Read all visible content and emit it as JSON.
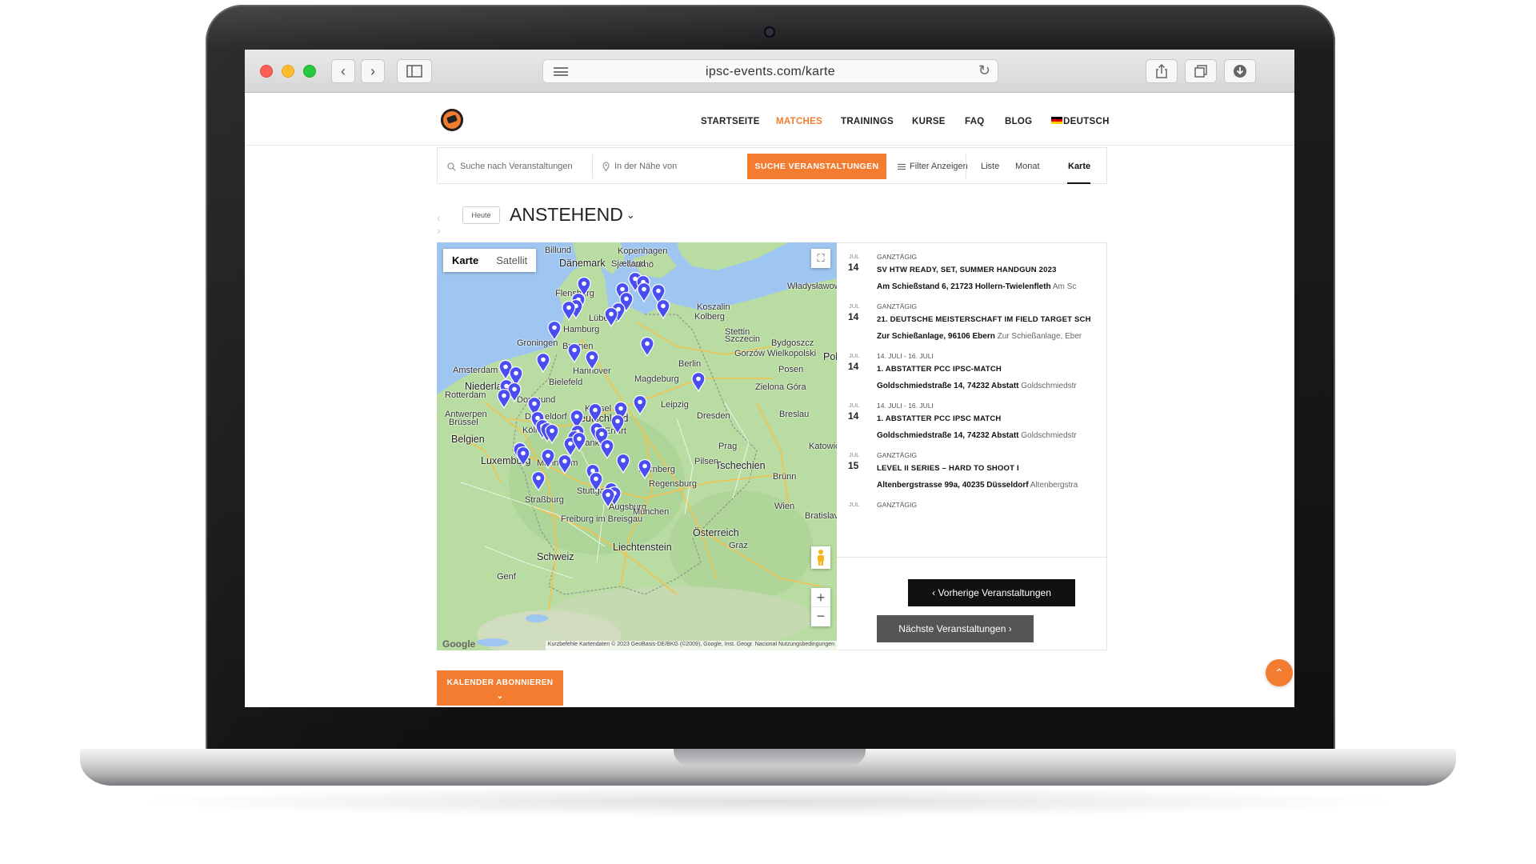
{
  "browser": {
    "url": "ipsc-events.com/karte",
    "back_glyph": "‹",
    "forward_glyph": "›"
  },
  "nav": {
    "items": [
      "STARTSEITE",
      "MATCHES",
      "TRAININGS",
      "KURSE",
      "FAQ",
      "BLOG"
    ],
    "active": "MATCHES",
    "language": "DEUTSCH"
  },
  "search": {
    "keyword_placeholder": "Suche nach Veranstaltungen",
    "location_placeholder": "In der Nähe von",
    "submit_label": "SUCHE VERANSTALTUNGEN",
    "filter_label": "Filter Anzeigen",
    "views": [
      "Liste",
      "Monat",
      "Karte"
    ],
    "active_view": "Karte"
  },
  "datenav": {
    "today_label": "Heute",
    "heading": "ANSTEHEND"
  },
  "map": {
    "type_buttons": [
      "Karte",
      "Satellit"
    ],
    "active_type": "Karte",
    "labels": [
      {
        "text": "Kopenhagen",
        "big": false
      },
      {
        "text": "Dänemark",
        "big": true
      },
      {
        "text": "Malmö",
        "big": false
      },
      {
        "text": "Billund",
        "big": false
      },
      {
        "text": "Sjælland",
        "big": false
      },
      {
        "text": "Władysławowo",
        "big": false
      },
      {
        "text": "Flensburg",
        "big": false
      },
      {
        "text": "Lübeck",
        "big": false
      },
      {
        "text": "Hamburg",
        "big": false
      },
      {
        "text": "Bremen",
        "big": false
      },
      {
        "text": "Groningen",
        "big": false
      },
      {
        "text": "Szczecin",
        "big": false
      },
      {
        "text": "Stettin",
        "big": false
      },
      {
        "text": "Koszalin",
        "big": false
      },
      {
        "text": "Kolberg",
        "big": false
      },
      {
        "text": "Bydgoszcz",
        "big": false
      },
      {
        "text": "Pol",
        "big": true
      },
      {
        "text": "Amsterdam",
        "big": false
      },
      {
        "text": "Niederlande",
        "big": true
      },
      {
        "text": "Rotterdam",
        "big": false
      },
      {
        "text": "Antwerpen",
        "big": false
      },
      {
        "text": "Brüssel",
        "big": false
      },
      {
        "text": "Belgien",
        "big": true
      },
      {
        "text": "Luxemburg",
        "big": true
      },
      {
        "text": "Dortmund",
        "big": false
      },
      {
        "text": "Düsseldorf",
        "big": false
      },
      {
        "text": "Köln",
        "big": false
      },
      {
        "text": "Bielefeld",
        "big": false
      },
      {
        "text": "Hannover",
        "big": false
      },
      {
        "text": "Magdeburg",
        "big": false
      },
      {
        "text": "Berlin",
        "big": false
      },
      {
        "text": "Gorzów Wielkopolski",
        "big": false
      },
      {
        "text": "Posen",
        "big": false
      },
      {
        "text": "Zielona Góra",
        "big": false
      },
      {
        "text": "Kassel",
        "big": false
      },
      {
        "text": "Leipzig",
        "big": false
      },
      {
        "text": "Dresden",
        "big": false
      },
      {
        "text": "Breslau",
        "big": false
      },
      {
        "text": "Deutschland",
        "big": true
      },
      {
        "text": "Erfurt",
        "big": false
      },
      {
        "text": "Frankfurt",
        "big": false
      },
      {
        "text": "Prag",
        "big": false
      },
      {
        "text": "Tschechien",
        "big": true
      },
      {
        "text": "Katowice",
        "big": false
      },
      {
        "text": "Nürnberg",
        "big": false
      },
      {
        "text": "Pilsen",
        "big": false
      },
      {
        "text": "Mannheim",
        "big": false
      },
      {
        "text": "Stuttgart",
        "big": false
      },
      {
        "text": "Regensburg",
        "big": false
      },
      {
        "text": "Brünn",
        "big": false
      },
      {
        "text": "Straßburg",
        "big": false
      },
      {
        "text": "Augsburg",
        "big": false
      },
      {
        "text": "München",
        "big": false
      },
      {
        "text": "Wien",
        "big": false
      },
      {
        "text": "Bratislava",
        "big": false
      },
      {
        "text": "Freiburg im Breisgau",
        "big": false
      },
      {
        "text": "Österreich",
        "big": true
      },
      {
        "text": "Liechtenstein",
        "big": true
      },
      {
        "text": "Graz",
        "big": false
      },
      {
        "text": "Schweiz",
        "big": true
      },
      {
        "text": "Genf",
        "big": false
      }
    ],
    "google_logo": "Google",
    "attribution": "Kurzbefehle   Kartendaten © 2023 GeoBasis-DE/BKG (©2009), Google, Inst. Geogr. Nacional   Nutzungsbedingungen",
    "zoom_in": "+",
    "zoom_out": "−",
    "fullscreen_icon": "⛶",
    "pegman_icon": "person-icon",
    "marker_color": "#4a4ef0"
  },
  "events": [
    {
      "month": "JUL",
      "day": "14",
      "when": "GANZTÄGIG",
      "title": "SV HTW READY, SET, SUMMER HANDGUN 2023",
      "address_bold": "Am Schießstand 6, 21723 Hollern-Twielenfleth",
      "address_rest": "Am Sc"
    },
    {
      "month": "JUL",
      "day": "14",
      "when": "GANZTÄGIG",
      "title": "21. DEUTSCHE MEISTERSCHAFT IM FIELD TARGET SCH",
      "address_bold": "Zur Schießanlage, 96106 Ebern",
      "address_rest": "Zur Schießanlage, Eber"
    },
    {
      "month": "JUL",
      "day": "14",
      "when": "14. JULI - 16. JULI",
      "title": "1. ABSTATTER PCC IPSC-MATCH",
      "address_bold": "Goldschmiedstraße 14, 74232 Abstatt",
      "address_rest": "Goldschmiedstr"
    },
    {
      "month": "JUL",
      "day": "14",
      "when": "14. JULI - 16. JULI",
      "title": "1. ABSTATTER PCC IPSC MATCH",
      "address_bold": "Goldschmiedstraße 14, 74232 Abstatt",
      "address_rest": "Goldschmiedstr"
    },
    {
      "month": "JUL",
      "day": "15",
      "when": "GANZTÄGIG",
      "title": "LEVEL II SERIES – HARD TO SHOOT I",
      "address_bold": "Altenbergstrasse 99a, 40235 Düsseldorf",
      "address_rest": "Altenbergstra"
    },
    {
      "month": "JUL",
      "day": "",
      "when": "GANZTÄGIG",
      "title": "",
      "address_bold": "",
      "address_rest": ""
    }
  ],
  "pagination": {
    "prev_label": "‹  Vorherige Veranstaltungen",
    "next_label": "Nächste Veranstaltungen  ›"
  },
  "subscribe": {
    "label": "KALENDER ABONNIEREN",
    "chevron": "⌄"
  },
  "to_top_glyph": "⌃",
  "colors": {
    "accent": "#f37c30",
    "marker": "#4a4ef0",
    "water": "#9fc6f1",
    "land": "#b7dca0"
  }
}
